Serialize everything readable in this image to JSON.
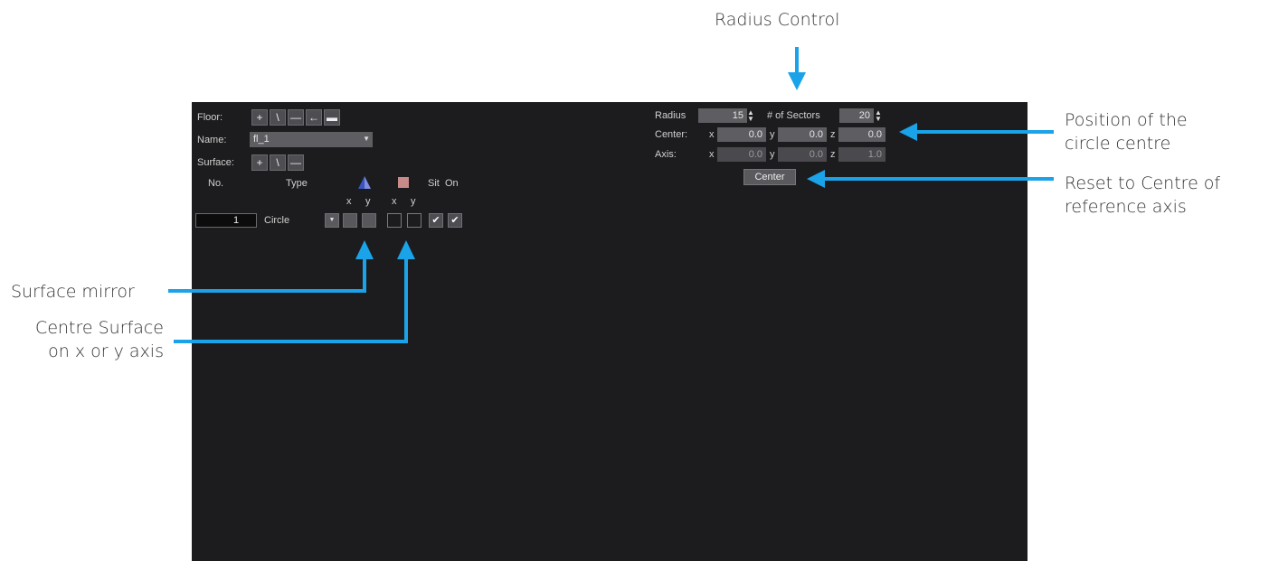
{
  "annotations": {
    "radius_control": "Radius Control",
    "circle_centre_line1": "Position of the",
    "circle_centre_line2": "circle centre",
    "reset_line1": "Reset to Centre of",
    "reset_line2": "reference axis",
    "surface_mirror": "Surface mirror",
    "centre_surface_line1": "Centre Surface",
    "centre_surface_line2": "on x or y axis"
  },
  "floor": {
    "label": "Floor:",
    "tools": [
      {
        "icon": "plus-icon",
        "glyph": "+"
      },
      {
        "icon": "pencil-icon",
        "glyph": "\\"
      },
      {
        "icon": "minus-icon",
        "glyph": "—"
      },
      {
        "icon": "import-icon",
        "glyph": "←"
      },
      {
        "icon": "folder-icon",
        "glyph": "▬"
      }
    ]
  },
  "name": {
    "label": "Name:",
    "value": "fl_1"
  },
  "surface": {
    "label": "Surface:",
    "tools": [
      {
        "icon": "plus-icon",
        "glyph": "+"
      },
      {
        "icon": "pencil-icon",
        "glyph": "\\"
      },
      {
        "icon": "minus-icon",
        "glyph": "—"
      }
    ]
  },
  "table": {
    "headers": {
      "no": "No.",
      "type": "Type",
      "sit": "Sit",
      "on": "On"
    },
    "sub_headers": [
      "x",
      "y",
      "x",
      "y"
    ],
    "rows": [
      {
        "no": "1",
        "type": "Circle",
        "mirror_x": false,
        "mirror_y": false,
        "centre_x": false,
        "centre_y": false,
        "sit": true,
        "on": true
      }
    ]
  },
  "radius": {
    "label": "Radius",
    "value": "15",
    "sectors_label": "# of Sectors",
    "sectors_value": "20"
  },
  "center": {
    "label": "Center:",
    "x_label": "x",
    "x": "0.0",
    "y_label": "y",
    "y": "0.0",
    "z_label": "z",
    "z": "0.0"
  },
  "axis": {
    "label": "Axis:",
    "x_label": "x",
    "x": "0.0",
    "y_label": "y",
    "y": "0.0",
    "z_label": "z",
    "z": "1.0"
  },
  "center_button": "Center",
  "colors": {
    "accent_arrow": "#1aa3e8",
    "panel": "#1c1c1e",
    "mirror_icon": "#4a63c8",
    "centre_icon": "#c98a8a"
  },
  "icons": {
    "mirror": "mirror-icon",
    "centre": "centre-surface-icon",
    "arrow": "arrow-icon"
  }
}
